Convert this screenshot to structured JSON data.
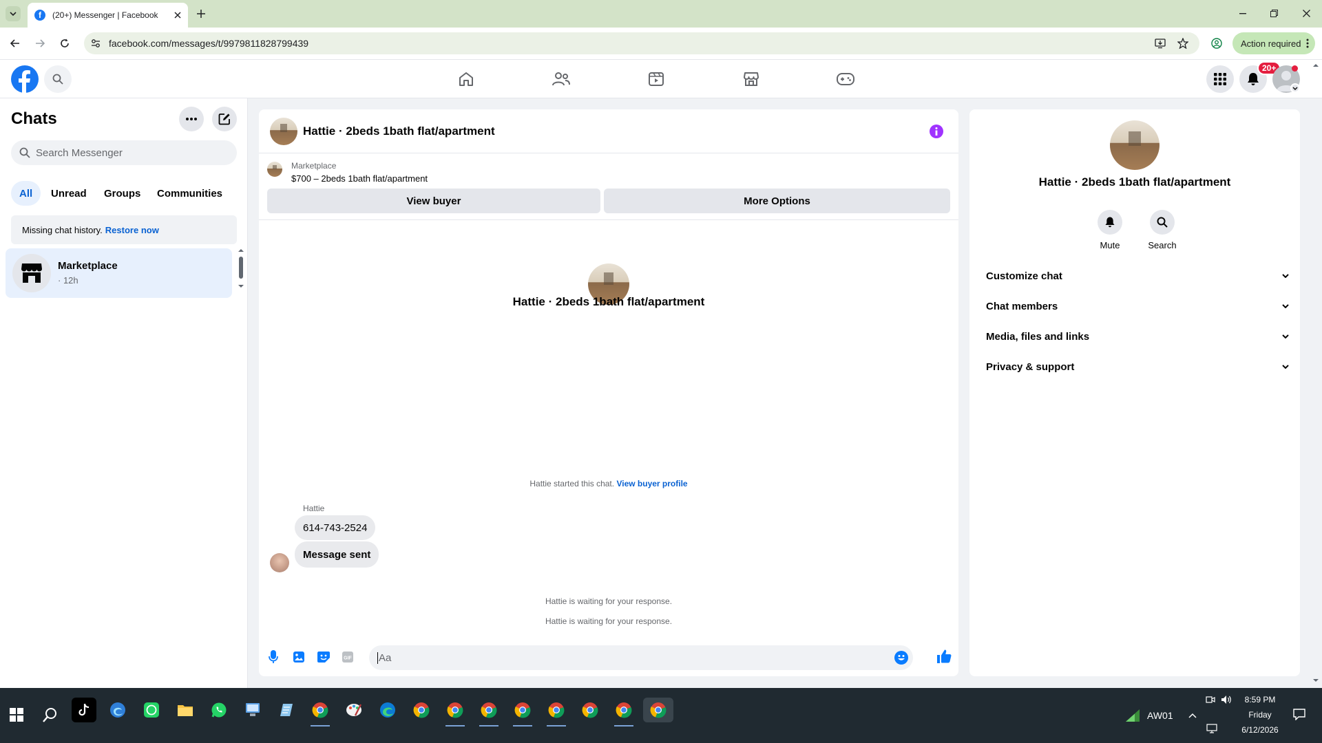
{
  "browser": {
    "tab_title": "(20+) Messenger | Facebook",
    "url": "facebook.com/messages/t/9979811828799439",
    "action_required": "Action required"
  },
  "fb_header": {
    "notification_badge": "20+"
  },
  "sidebar": {
    "title": "Chats",
    "search_placeholder": "Search Messenger",
    "filters": [
      "All",
      "Unread",
      "Groups",
      "Communities"
    ],
    "missing_history": "Missing chat history.",
    "restore_link": "Restore now",
    "chats": [
      {
        "name": "Marketplace",
        "meta": "· 12h"
      }
    ]
  },
  "conversation": {
    "header_title": "Hattie · 2beds 1bath flat/apartment",
    "marketplace_label": "Marketplace",
    "listing": "$700 – 2beds 1bath flat/apartment",
    "view_buyer": "View buyer",
    "more_options": "More Options",
    "intro_name": "Hattie · 2beds 1bath flat/apartment",
    "started_text": "Hattie started this chat.",
    "view_buyer_profile": "View buyer profile",
    "sender_name": "Hattie",
    "messages": [
      "614-743-2524",
      "Message sent"
    ],
    "waiting_1": "Hattie is waiting for your response.",
    "waiting_2": "Hattie is waiting for your response.",
    "composer_placeholder": "Aa"
  },
  "details": {
    "name": "Hattie · 2beds 1bath flat/apartment",
    "mute": "Mute",
    "search": "Search",
    "sections": [
      "Customize chat",
      "Chat members",
      "Media, files and links",
      "Privacy & support"
    ]
  },
  "taskbar": {
    "network": "AW01",
    "time": "8:59 PM",
    "day": "Friday",
    "date": "6/12/2026"
  },
  "colors": {
    "brand": "#1877f2",
    "accent_purple": "#a033ff",
    "badge_red": "#e41e3f"
  }
}
